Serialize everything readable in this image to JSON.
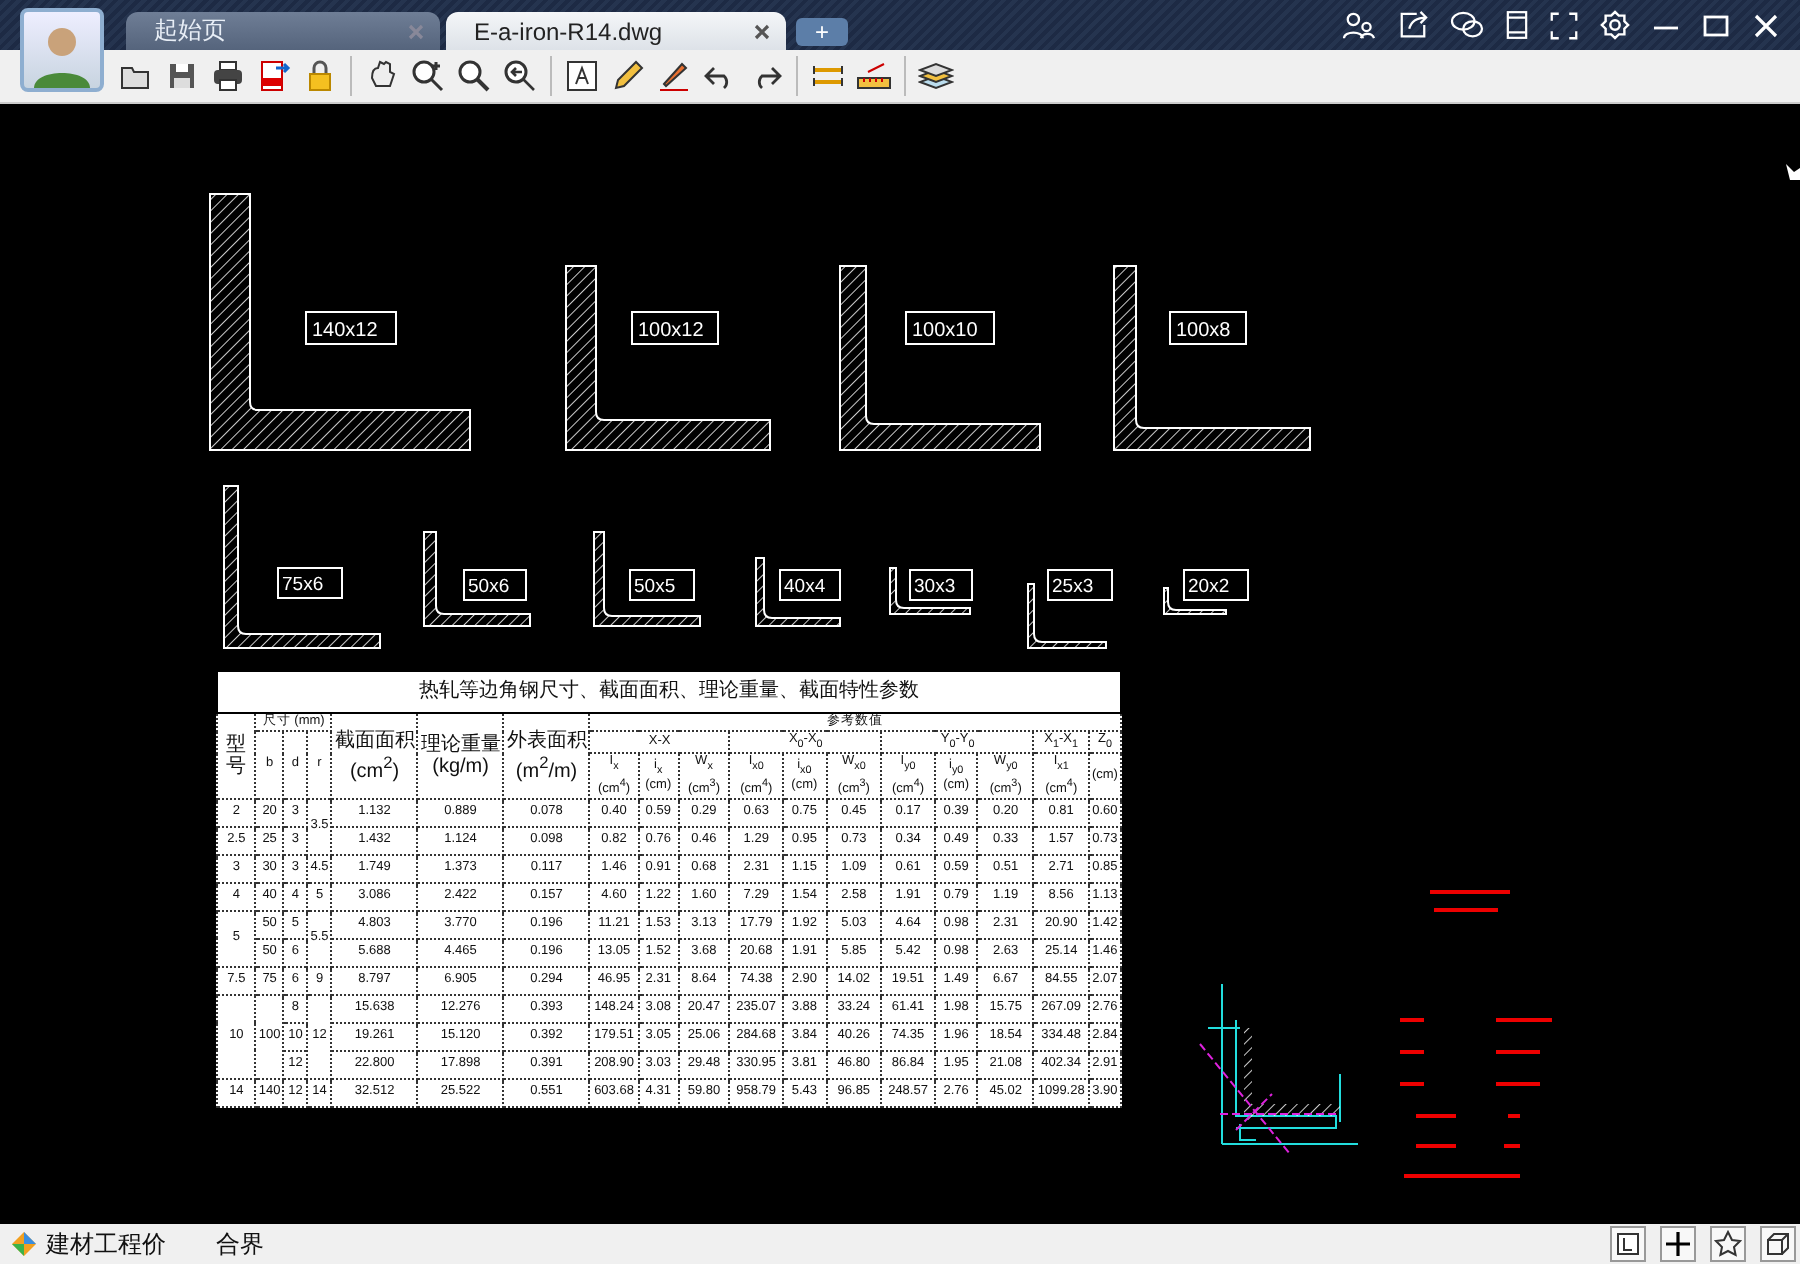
{
  "tabs": [
    {
      "label": "起始页",
      "selected": false
    },
    {
      "label": "E-a-iron-R14.dwg",
      "selected": true
    }
  ],
  "new_tab": "+",
  "drawing": {
    "large_angles": [
      {
        "label": "140x12"
      },
      {
        "label": "100x12"
      },
      {
        "label": "100x10"
      },
      {
        "label": "100x8"
      }
    ],
    "small_angles": [
      {
        "label": "75x6"
      },
      {
        "label": "50x6"
      },
      {
        "label": "50x5"
      },
      {
        "label": "40x4"
      },
      {
        "label": "30x3"
      },
      {
        "label": "25x3"
      },
      {
        "label": "20x2"
      }
    ],
    "table": {
      "title": "热轧等边角钢尺寸、截面面积、理论重量、截面特性参数",
      "header": {
        "model": "型号",
        "size": "尺寸 (mm)",
        "size_cols": [
          "b",
          "d",
          "r"
        ],
        "area": "截面面积 (cm$^{2}$)",
        "weight": "理论重量 (kg/m)",
        "surface": "外表面积 (m$^{2}$/m)",
        "reference": "参考数值",
        "groups": [
          {
            "label": "X-X",
            "cols": [
              "I$_{x}$ (cm$^{4}$)",
              "i$_{x}$ (cm)",
              "W$_{x}$ (cm$^{3}$)"
            ]
          },
          {
            "label": "X$_{0}$-X$_{0}$",
            "cols": [
              "I$_{x0}$ (cm$^{4}$)",
              "i$_{x0}$ (cm)",
              "W$_{x0}$ (cm$^{3}$)"
            ]
          },
          {
            "label": "Y$_{0}$-Y$_{0}$",
            "cols": [
              "I$_{y0}$ (cm$^{4}$)",
              "i$_{y0}$ (cm)",
              "W$_{y0}$ (cm$^{3}$)"
            ]
          },
          {
            "label": "X$_{1}$-X$_{1}$",
            "cols": [
              "I$_{x1}$ (cm$^{4}$)"
            ]
          },
          {
            "label": "Z$_{0}$",
            "cols": [
              "(cm)"
            ]
          }
        ]
      },
      "rows": [
        [
          "2",
          "20",
          "3",
          {
            "text": "3.5",
            "rowspan": 2
          },
          "1.132",
          "0.889",
          "0.078",
          "0.40",
          "0.59",
          "0.29",
          "0.63",
          "0.75",
          "0.45",
          "0.17",
          "0.39",
          "0.20",
          "0.81",
          "0.60"
        ],
        [
          "2.5",
          "25",
          "3",
          "1.432",
          "1.124",
          "0.098",
          "0.82",
          "0.76",
          "0.46",
          "1.29",
          "0.95",
          "0.73",
          "0.34",
          "0.49",
          "0.33",
          "1.57",
          "0.73"
        ],
        [
          "3",
          "30",
          "3",
          "4.5",
          "1.749",
          "1.373",
          "0.117",
          "1.46",
          "0.91",
          "0.68",
          "2.31",
          "1.15",
          "1.09",
          "0.61",
          "0.59",
          "0.51",
          "2.71",
          "0.85"
        ],
        [
          "4",
          "40",
          "4",
          "5",
          "3.086",
          "2.422",
          "0.157",
          "4.60",
          "1.22",
          "1.60",
          "7.29",
          "1.54",
          "2.58",
          "1.91",
          "0.79",
          "1.19",
          "8.56",
          "1.13"
        ],
        [
          {
            "text": "5",
            "rowspan": 2
          },
          "50",
          "5",
          {
            "text": "5.5",
            "rowspan": 2
          },
          "4.803",
          "3.770",
          "0.196",
          "11.21",
          "1.53",
          "3.13",
          "17.79",
          "1.92",
          "5.03",
          "4.64",
          "0.98",
          "2.31",
          "20.90",
          "1.42"
        ],
        [
          "50",
          "6",
          "5.688",
          "4.465",
          "0.196",
          "13.05",
          "1.52",
          "3.68",
          "20.68",
          "1.91",
          "5.85",
          "5.42",
          "0.98",
          "2.63",
          "25.14",
          "1.46"
        ],
        [
          "7.5",
          "75",
          "6",
          "9",
          "8.797",
          "6.905",
          "0.294",
          "46.95",
          "2.31",
          "8.64",
          "74.38",
          "2.90",
          "14.02",
          "19.51",
          "1.49",
          "6.67",
          "84.55",
          "2.07"
        ],
        [
          {
            "text": "10",
            "rowspan": 3
          },
          {
            "text": "100",
            "rowspan": 3
          },
          "8",
          {
            "text": "12",
            "rowspan": 3
          },
          "15.638",
          "12.276",
          "0.393",
          "148.24",
          "3.08",
          "20.47",
          "235.07",
          "3.88",
          "33.24",
          "61.41",
          "1.98",
          "15.75",
          "267.09",
          "2.76"
        ],
        [
          "10",
          "19.261",
          "15.120",
          "0.392",
          "179.51",
          "3.05",
          "25.06",
          "284.68",
          "3.84",
          "40.26",
          "74.35",
          "1.96",
          "18.54",
          "334.48",
          "2.84"
        ],
        [
          "12",
          "22.800",
          "17.898",
          "0.391",
          "208.90",
          "3.03",
          "29.48",
          "330.95",
          "3.81",
          "46.80",
          "86.84",
          "1.95",
          "21.08",
          "402.34",
          "2.91"
        ],
        [
          "14",
          "140",
          "12",
          "14",
          "32.512",
          "25.522",
          "0.551",
          "603.68",
          "4.31",
          "59.80",
          "958.79",
          "5.43",
          "96.85",
          "248.57",
          "2.76",
          "45.02",
          "1099.28",
          "3.90"
        ]
      ]
    }
  },
  "status_bar": {
    "app": "建材工程价",
    "item": "合界"
  }
}
